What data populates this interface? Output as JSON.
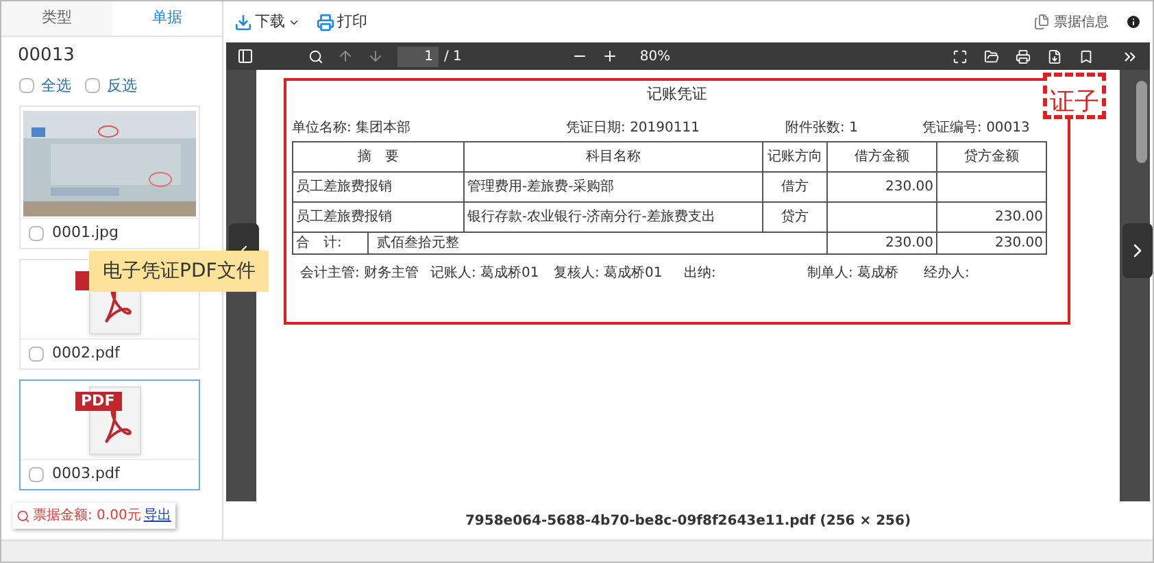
{
  "sidebar": {
    "tabs": [
      {
        "label": "类型",
        "selected": false
      },
      {
        "label": "单据",
        "selected": true
      }
    ],
    "voucher_number": "00013",
    "options": [
      {
        "label": "全选",
        "checked": false
      },
      {
        "label": "反选",
        "checked": false
      }
    ],
    "files": [
      {
        "name": "0001.jpg",
        "kind": "picture",
        "checked": false,
        "selected": false
      },
      {
        "name": "0002.pdf",
        "kind": "pdf",
        "checked": false,
        "selected": false
      },
      {
        "name": "0003.pdf",
        "kind": "pdf",
        "badge": "PDF",
        "checked": false,
        "selected": true
      }
    ],
    "total": {
      "label": "票据金额: 0.00元",
      "link": "导出"
    }
  },
  "toolbar": {
    "buttons": [
      {
        "label": "下载",
        "kind": "download"
      },
      {
        "label": "打印",
        "kind": "print"
      }
    ],
    "info": "票据信息"
  },
  "viewer": {
    "page_input": "1",
    "page_count": "/ 1",
    "zoom": "80%"
  },
  "document": {
    "title": "记账凭证",
    "stamp": "证子",
    "meta": [
      {
        "label": "单位名称:",
        "value": "集团本部"
      },
      {
        "label": "凭证日期:",
        "value": "20190111"
      },
      {
        "label": "附件张数:",
        "value": "1"
      },
      {
        "label": "凭证编号:",
        "value": "00013"
      }
    ],
    "columns": [
      "摘　要",
      "科目名称",
      "记账方向",
      "借方金额",
      "贷方金额"
    ],
    "rows": [
      [
        "员工差旅费报销",
        "管理费用-差旅费-采购部",
        "借方",
        "230.00",
        ""
      ],
      [
        "员工差旅费报销",
        "银行存款-农业银行-济南分行-差旅费支出",
        "贷方",
        "",
        "230.00"
      ]
    ],
    "total": {
      "label": "合　计:",
      "words": "贰佰叁拾元整",
      "debit": "230.00",
      "credit": "230.00"
    },
    "signatures": [
      {
        "label": "会计主管:",
        "value": "财务主管"
      },
      {
        "label": "记账人:",
        "value": "葛成桥01"
      },
      {
        "label": "复核人:",
        "value": "葛成桥01"
      },
      {
        "label": "出纳:"
      },
      {
        "label": "制单人:",
        "value": "葛成桥"
      },
      {
        "label": "经办人:"
      }
    ]
  },
  "callout": "电子凭证PDF文件",
  "caption": "7958e064-5688-4b70-be8c-09f8f2643e11.pdf (256 × 256)"
}
